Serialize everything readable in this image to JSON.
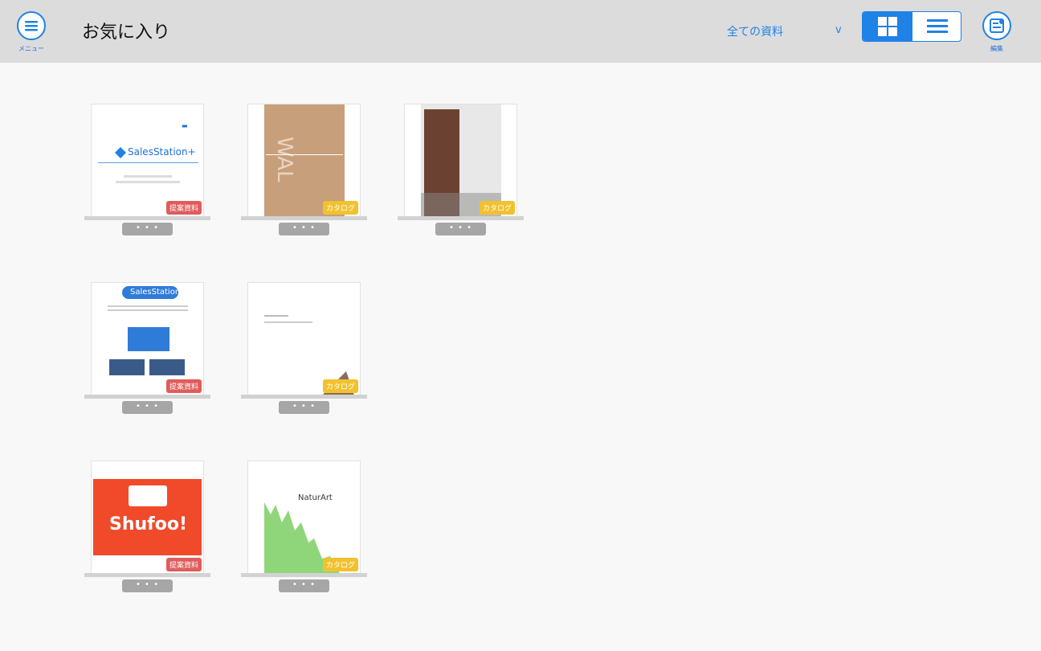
{
  "header": {
    "menu_label": "メニュー",
    "title": "お気に入り",
    "filter_value": "全ての資料",
    "filter_chevron": "v",
    "edit_label": "編集"
  },
  "items": [
    {
      "badge": "提案資料",
      "badge_color": "#e05c5c",
      "more": "• • •",
      "thumb_text": "SalesStation+"
    },
    {
      "badge": "カタログ",
      "badge_color": "#f2c12e",
      "more": "• • •",
      "thumb_text": "WAL"
    },
    {
      "badge": "カタログ",
      "badge_color": "#f2c12e",
      "more": "• • •",
      "thumb_text": ""
    },
    {
      "badge": "提案資料",
      "badge_color": "#e05c5c",
      "more": "• • •",
      "thumb_text": "SalesStation+"
    },
    {
      "badge": "カタログ",
      "badge_color": "#f2c12e",
      "more": "• • •",
      "thumb_text": ""
    },
    {
      "badge": "提案資料",
      "badge_color": "#e05c5c",
      "more": "• • •",
      "thumb_text": "Shufoo!"
    },
    {
      "badge": "カタログ",
      "badge_color": "#f2c12e",
      "more": "• • •",
      "thumb_text": "NaturArt"
    }
  ],
  "accent_color": "#1e82e6"
}
